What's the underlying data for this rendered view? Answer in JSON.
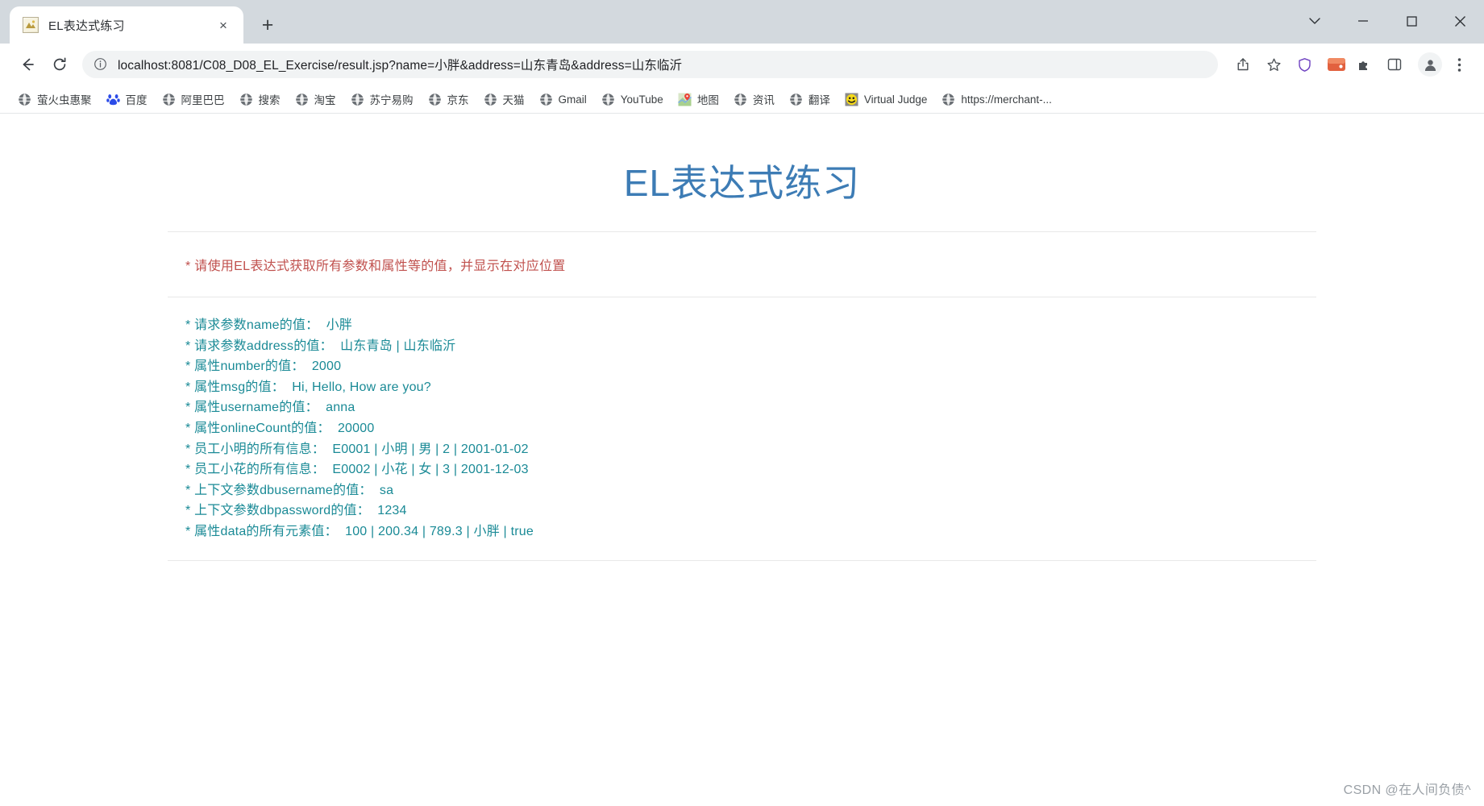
{
  "window": {
    "controls": {
      "list": "list-icon",
      "minimize": "minimize-icon",
      "maximize": "maximize-icon",
      "close": "close-icon"
    }
  },
  "tabstrip": {
    "tabs": [
      {
        "title": "EL表达式练习",
        "favicon": "page-favicon"
      }
    ],
    "new_tab_label": "+",
    "close_label": "×"
  },
  "toolbar": {
    "back": "back-arrow-icon",
    "forward": "forward-arrow-icon",
    "reload": "reload-icon",
    "url": "localhost:8081/C08_D08_EL_Exercise/result.jsp?name=小胖&address=山东青岛&address=山东临沂",
    "url_host": "localhost",
    "url_rest": ":8081/C08_D08_EL_Exercise/result.jsp?name=小胖&address=山东青岛&address=山东临沂",
    "placeholder": "Search Google or type a URL",
    "icons": [
      "share-icon",
      "bookmark-star-icon",
      "shield-icon",
      "extension-puzzle-icon",
      "side-panel-icon",
      "profile-avatar-icon",
      "menu-kebab-icon"
    ]
  },
  "bookmarks": [
    {
      "label": "萤火虫惠聚",
      "icon": "globe-icon"
    },
    {
      "label": "百度",
      "icon": "baidu-icon"
    },
    {
      "label": "阿里巴巴",
      "icon": "globe-icon"
    },
    {
      "label": "搜索",
      "icon": "globe-icon"
    },
    {
      "label": "淘宝",
      "icon": "globe-icon"
    },
    {
      "label": "苏宁易购",
      "icon": "globe-icon"
    },
    {
      "label": "京东",
      "icon": "globe-icon"
    },
    {
      "label": "天猫",
      "icon": "globe-icon"
    },
    {
      "label": "Gmail",
      "icon": "globe-icon"
    },
    {
      "label": "YouTube",
      "icon": "globe-icon"
    },
    {
      "label": "地图",
      "icon": "google-maps-icon"
    },
    {
      "label": "资讯",
      "icon": "globe-icon"
    },
    {
      "label": "翻译",
      "icon": "globe-icon"
    },
    {
      "label": "Virtual Judge",
      "icon": "smiley-icon"
    },
    {
      "label": "https://merchant-...",
      "icon": "globe-icon"
    }
  ],
  "page": {
    "title": "EL表达式练习",
    "title_color": "#3d7cb5",
    "notice": "* 请使用EL表达式获取所有参数和属性等的值，并显示在对应位置",
    "notice_color": "#c0504d",
    "result_color": "#1a8a96",
    "results": [
      "* 请求参数name的值：  小胖",
      "* 请求参数address的值：  山东青岛 | 山东临沂",
      "* 属性number的值：  2000",
      "* 属性msg的值：  Hi, Hello, How are you?",
      "* 属性username的值：  anna",
      "* 属性onlineCount的值：  20000",
      "* 员工小明的所有信息：  E0001 | 小明 | 男 | 2 | 2001-01-02",
      "* 员工小花的所有信息：  E0002 | 小花 | 女 | 3 | 2001-12-03",
      "* 上下文参数dbusername的值：  sa",
      "* 上下文参数dbpassword的值：  1234",
      "* 属性data的所有元素值：  100 | 200.34 | 789.3 | 小胖 | true"
    ]
  },
  "watermark": "CSDN @在人间负债^"
}
